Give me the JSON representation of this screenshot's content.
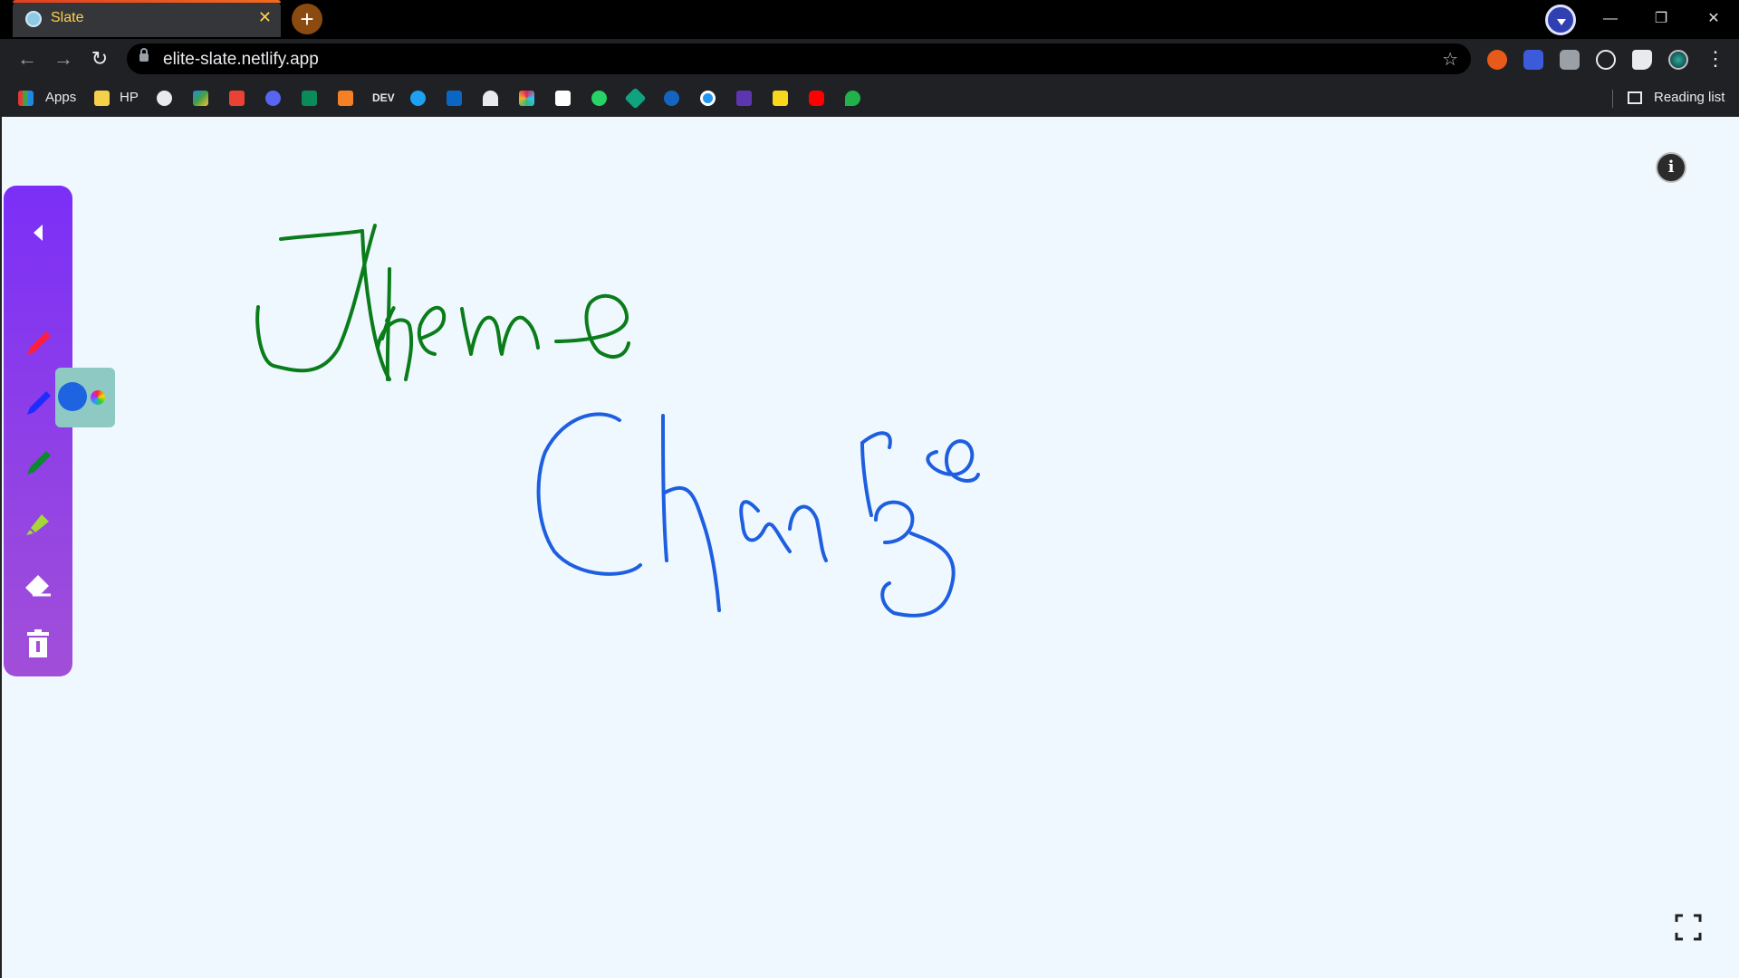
{
  "browser": {
    "tab_title": "Slate",
    "tab_close": "✕",
    "new_tab": "+",
    "url": "elite-slate.netlify.app",
    "window": {
      "minimize": "—",
      "restore": "❐",
      "close": "✕"
    },
    "nav": {
      "back": "←",
      "forward": "→",
      "reload": "↻",
      "star": "☆",
      "menu": "⋮"
    },
    "bookmarks": [
      "Apps",
      "HP",
      "DEV"
    ],
    "reading_list": "Reading list"
  },
  "app": {
    "info_label": "i",
    "tools": [
      {
        "name": "collapse",
        "icon": "caret-left-icon"
      },
      {
        "name": "red-pen",
        "icon": "pen-icon",
        "color": "#ff1e3c"
      },
      {
        "name": "blue-pen",
        "icon": "pen-icon",
        "color": "#1e2cff"
      },
      {
        "name": "green-pen",
        "icon": "pen-icon",
        "color": "#0a8a2a"
      },
      {
        "name": "highlighter",
        "icon": "highlighter-icon",
        "color": "#a6d63a"
      },
      {
        "name": "eraser",
        "icon": "eraser-icon"
      },
      {
        "name": "clear",
        "icon": "trash-icon"
      }
    ],
    "current_color": "#1e64e0"
  },
  "canvas": {
    "handwriting": [
      "Theme",
      "Change"
    ],
    "colors": {
      "theme": "#0a7d1a",
      "change": "#1e5fe0"
    }
  }
}
